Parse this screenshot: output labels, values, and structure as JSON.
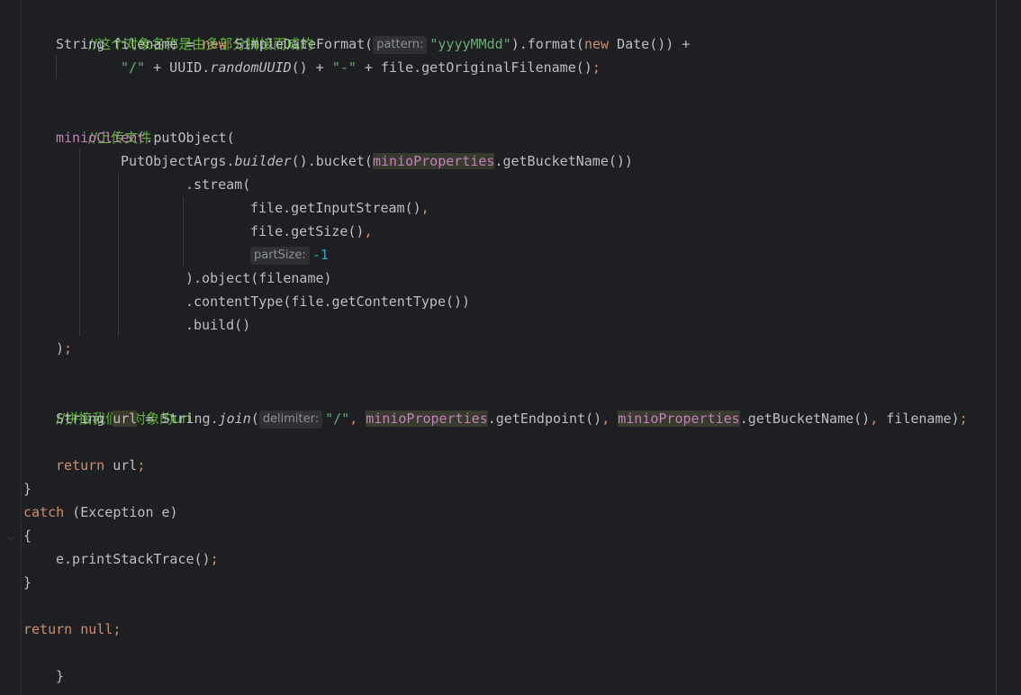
{
  "code": {
    "comment_filename": "//这个对象名称是由多部分拼接而成的",
    "line_filename_1": {
      "type": "String",
      "var": "filename",
      "assign": " = ",
      "kw_new": "new",
      "cls": "SimpleDateFormat(",
      "hint": "pattern:",
      "pattern": "\"yyyyMMdd\"",
      "format_call": ").format(",
      "kw_new2": "new",
      "date": " Date()) +"
    },
    "line_filename_2": {
      "slash": "\"/\"",
      "plus1": " + UUID.",
      "random": "randomUUID",
      "plus2": "() + ",
      "dash": "\"-\"",
      "rest": " + file.getOriginalFilename()",
      "semi": ";"
    },
    "comment_upload": "//上传文件",
    "line_put": {
      "field": "minioClient",
      "call": ".putObject("
    },
    "line_args": {
      "cls": "PutObjectArgs.",
      "builder": "builder",
      "bucket": "().bucket(",
      "props": "minioProperties",
      "getbucket": ".getBucketName())"
    },
    "line_stream": ".stream(",
    "line_input": {
      "text": "file.getInputStream()",
      "comma": ","
    },
    "line_size": {
      "text": "file.getSize()",
      "comma": ","
    },
    "line_partsize": {
      "hint": "partSize:",
      "value": "-1"
    },
    "line_object": ").object(filename)",
    "line_ctype": ".contentType(file.getContentType())",
    "line_build": ".build()",
    "line_close": {
      "paren": ")",
      "semi": ";"
    },
    "comment_url": "//拼接我们的对象的url",
    "line_url": {
      "type": "String ",
      "var": "url",
      "assign": " = String.",
      "join": "join",
      "open": "(",
      "hint": "delimiter:",
      "slash": "\"/\"",
      "comma1": ", ",
      "props1": "minioProperties",
      "endpoint": ".getEndpoint()",
      "comma2": ", ",
      "props2": "minioProperties",
      "getbucket": ".getBucketName()",
      "comma3": ", ",
      "fname": "filename)",
      "semi": ";"
    },
    "line_return_url": {
      "kw": "return",
      "rest": " url",
      "semi": ";"
    },
    "brace_close_try": "}",
    "line_catch": {
      "kw": "catch",
      "rest": " (Exception e)"
    },
    "brace_open_catch": "{",
    "line_print": {
      "text": "e.printStackTrace()",
      "semi": ";"
    },
    "brace_close_catch": "}",
    "line_return_null": {
      "kw": "return",
      "sp": " ",
      "kw_null": "null",
      "semi": ";"
    },
    "brace_close_method": "}"
  }
}
